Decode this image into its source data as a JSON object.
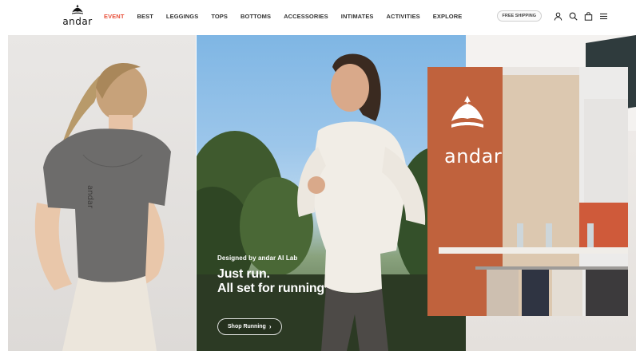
{
  "brand": {
    "logo_text": "andar",
    "accent": "#e8503a"
  },
  "nav": {
    "items": [
      {
        "label": "EVENT",
        "active": true
      },
      {
        "label": "BEST"
      },
      {
        "label": "LEGGINGS"
      },
      {
        "label": "TOPS"
      },
      {
        "label": "BOTTOMS"
      },
      {
        "label": "ACCESSORIES"
      },
      {
        "label": "INTIMATES"
      },
      {
        "label": "ACTIVITIES"
      },
      {
        "label": "EXPLORE"
      }
    ]
  },
  "utility": {
    "shipping_badge": "FREE SHIPPING",
    "icons": [
      "user-icon",
      "search-icon",
      "bag-icon",
      "menu-icon"
    ]
  },
  "hero": {
    "subtitle": "Designed by andar AI Lab",
    "title_line1": "Just run.",
    "title_line2": "All set for running",
    "cta_label": "Shop Running",
    "cta_arrow": "›",
    "sign_text": "andar"
  }
}
